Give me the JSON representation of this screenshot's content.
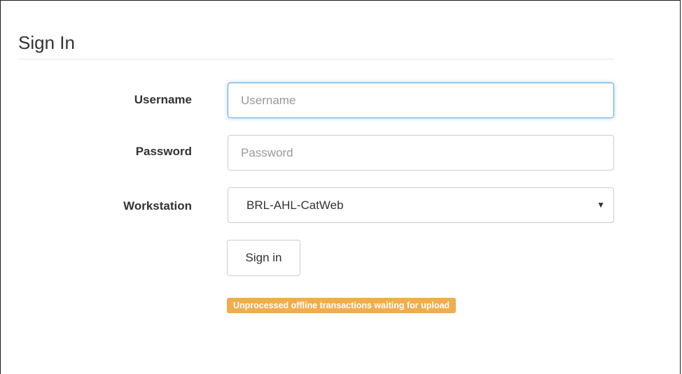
{
  "form": {
    "title": "Sign In",
    "username": {
      "label": "Username",
      "placeholder": "Username",
      "value": ""
    },
    "password": {
      "label": "Password",
      "placeholder": "Password",
      "value": ""
    },
    "workstation": {
      "label": "Workstation",
      "selected": "BRL-AHL-CatWeb"
    },
    "submit_label": "Sign in",
    "status_badge": "Unprocessed offline transactions waiting for upload"
  },
  "icons": {
    "workstation_caret": "▼"
  },
  "colors": {
    "focus_border": "#66afe9",
    "badge_background": "#f0ad4e",
    "badge_text": "#ffffff"
  }
}
